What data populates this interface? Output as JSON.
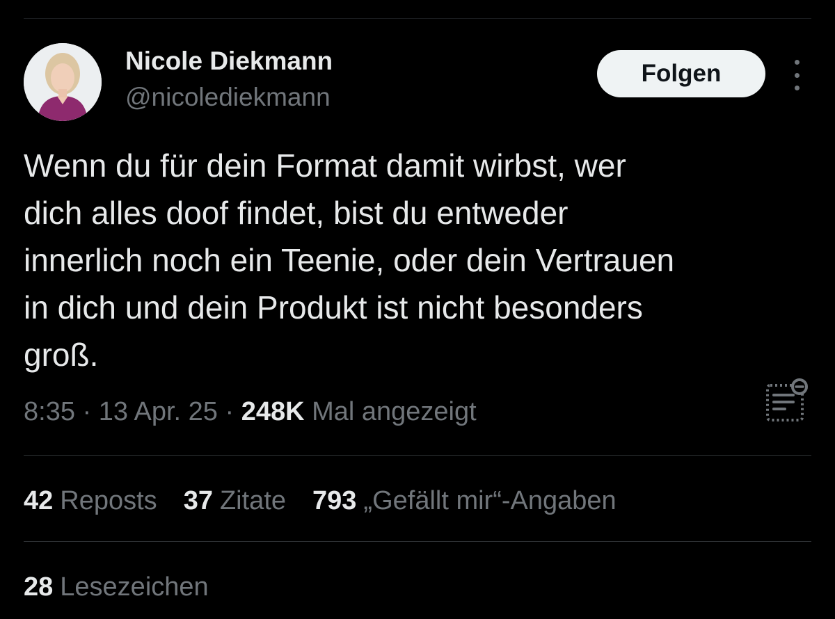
{
  "author": {
    "display_name": "Nicole Diekmann",
    "handle": "@nicolediekmann"
  },
  "follow_button": {
    "label": "Folgen"
  },
  "tweet": {
    "lines": [
      "Wenn du für dein Format damit wirbst, wer",
      "dich alles doof findet, bist du entweder",
      "innerlich noch ein Teenie, oder dein Vertrauen",
      "in dich und dein Produkt ist nicht besonders",
      "groß."
    ]
  },
  "meta": {
    "time": "8:35",
    "separator": "·",
    "date": "13 Apr. 25",
    "views_count": "248K",
    "views_label": "Mal angezeigt"
  },
  "stats": {
    "reposts_count": "42",
    "reposts_label": "Reposts",
    "quotes_count": "37",
    "quotes_label": "Zitate",
    "likes_count": "793",
    "likes_label": "„Gefällt mir“-Angaben",
    "bookmarks_count": "28",
    "bookmarks_label": "Lesezeichen"
  },
  "icons": {
    "more": "more-vertical-icon",
    "analytics": "post-analytics-icon"
  },
  "colors": {
    "background": "#000000",
    "primary_text": "#e7e9ea",
    "secondary_text": "#71767b",
    "divider": "#2f3336",
    "button_bg": "#eff3f4"
  }
}
